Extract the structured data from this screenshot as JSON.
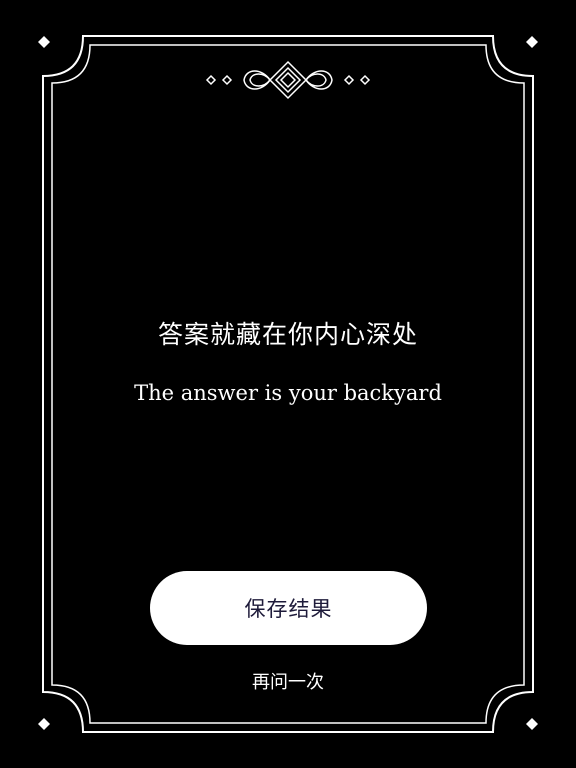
{
  "answer": {
    "chinese": "答案就藏在你内心深处",
    "english": "The answer is your backyard"
  },
  "actions": {
    "save_label": "保存结果",
    "ask_again_label": "再问一次"
  },
  "colors": {
    "background": "#000000",
    "frame": "#ffffff",
    "button_bg": "#ffffff",
    "button_text": "#1e1b3a",
    "text": "#ffffff"
  },
  "icons": {
    "top_ornament": "decorative-flourish-icon",
    "corners": "diamond-icon"
  }
}
